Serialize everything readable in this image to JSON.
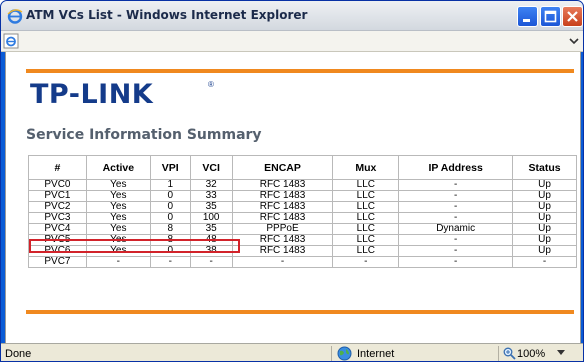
{
  "window": {
    "title": "ATM VCs List - Windows Internet Explorer"
  },
  "brand": {
    "logo_text": "TP-LINK",
    "logo_reg": "®"
  },
  "page": {
    "section_title": "Service Information Summary"
  },
  "table": {
    "headers": [
      "#",
      "Active",
      "VPI",
      "VCI",
      "ENCAP",
      "Mux",
      "IP Address",
      "Status"
    ],
    "rows": [
      [
        "PVC0",
        "Yes",
        "1",
        "32",
        "RFC 1483",
        "LLC",
        "-",
        "Up"
      ],
      [
        "PVC1",
        "Yes",
        "0",
        "33",
        "RFC 1483",
        "LLC",
        "-",
        "Up"
      ],
      [
        "PVC2",
        "Yes",
        "0",
        "35",
        "RFC 1483",
        "LLC",
        "-",
        "Up"
      ],
      [
        "PVC3",
        "Yes",
        "0",
        "100",
        "RFC 1483",
        "LLC",
        "-",
        "Up"
      ],
      [
        "PVC4",
        "Yes",
        "8",
        "35",
        "PPPoE",
        "LLC",
        "Dynamic",
        "Up"
      ],
      [
        "PVC5",
        "Yes",
        "8",
        "48",
        "RFC 1483",
        "LLC",
        "-",
        "Up"
      ],
      [
        "PVC6",
        "Yes",
        "0",
        "38",
        "RFC 1483",
        "LLC",
        "-",
        "Up"
      ],
      [
        "PVC7",
        "-",
        "-",
        "-",
        "-",
        "-",
        "-",
        "-"
      ]
    ]
  },
  "statusbar": {
    "status": "Done",
    "zone": "Internet",
    "zoom": "100%"
  },
  "colors": {
    "accent_orange": "#f0891f",
    "logo_blue": "#143b8a",
    "highlight_red": "#d2232a"
  },
  "icons": [
    "ie-icon",
    "minimize-icon",
    "maximize-icon",
    "close-icon",
    "page-icon",
    "chevron-down-icon",
    "globe-icon",
    "zoom-icon"
  ]
}
